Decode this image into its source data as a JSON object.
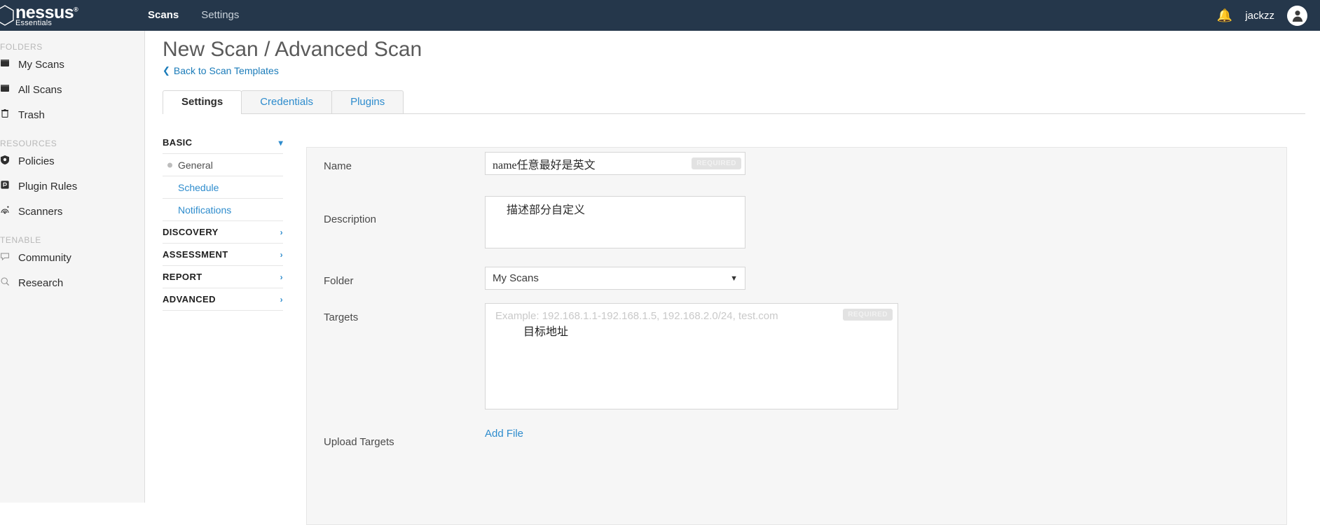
{
  "brand": {
    "name": "nessus",
    "trademark": "®",
    "edition": "Essentials",
    "logo_icon": "nessus-logo-icon"
  },
  "topnav": {
    "background": "#25374b",
    "links": [
      {
        "label": "Scans",
        "active": true
      },
      {
        "label": "Settings",
        "active": false
      }
    ],
    "notifications_icon": "bell-icon",
    "username": "jackzz",
    "avatar_icon": "user-avatar-icon"
  },
  "sidebar": {
    "groups": [
      {
        "title": "FOLDERS",
        "items": [
          {
            "label": "My Scans",
            "icon": "folder-icon"
          },
          {
            "label": "All Scans",
            "icon": "folder-icon"
          },
          {
            "label": "Trash",
            "icon": "trash-icon"
          }
        ]
      },
      {
        "title": "RESOURCES",
        "items": [
          {
            "label": "Policies",
            "icon": "shield-icon"
          },
          {
            "label": "Plugin Rules",
            "icon": "plugin-icon"
          },
          {
            "label": "Scanners",
            "icon": "scanner-icon"
          }
        ]
      },
      {
        "title": "TENABLE",
        "items": [
          {
            "label": "Community",
            "icon": "community-icon"
          },
          {
            "label": "Research",
            "icon": "research-icon"
          }
        ]
      }
    ]
  },
  "page": {
    "title": "New Scan / Advanced Scan",
    "back_link": "Back to Scan Templates",
    "back_chevron": "chevron-left-icon"
  },
  "tabs": [
    {
      "label": "Settings",
      "active": true
    },
    {
      "label": "Credentials",
      "active": false
    },
    {
      "label": "Plugins",
      "active": false
    }
  ],
  "settings_nav": [
    {
      "label": "BASIC",
      "expanded": true,
      "arrow": "chevron-down-icon",
      "children": [
        {
          "label": "General",
          "current": true
        },
        {
          "label": "Schedule",
          "current": false
        },
        {
          "label": "Notifications",
          "current": false
        }
      ]
    },
    {
      "label": "DISCOVERY",
      "expanded": false,
      "arrow": "chevron-right-icon",
      "children": []
    },
    {
      "label": "ASSESSMENT",
      "expanded": false,
      "arrow": "chevron-right-icon",
      "children": []
    },
    {
      "label": "REPORT",
      "expanded": false,
      "arrow": "chevron-right-icon",
      "children": []
    },
    {
      "label": "ADVANCED",
      "expanded": false,
      "arrow": "chevron-right-icon",
      "children": []
    }
  ],
  "form": {
    "name": {
      "label": "Name",
      "value": "name任意最好是英文",
      "placeholder": "",
      "required_badge": "REQUIRED"
    },
    "description": {
      "label": "Description",
      "value": "描述部分自定义",
      "placeholder": ""
    },
    "folder": {
      "label": "Folder",
      "value": "My Scans",
      "caret": "caret-down-icon",
      "options": [
        "My Scans"
      ]
    },
    "targets": {
      "label": "Targets",
      "value": "",
      "placeholder": "Example: 192.168.1.1-192.168.1.5, 192.168.2.0/24, test.com",
      "annotation": "目标地址",
      "required_badge": "REQUIRED"
    },
    "upload_targets": {
      "label": "Upload Targets",
      "add_file_label": "Add File"
    }
  },
  "colors": {
    "navbar": "#25374b",
    "link": "#2e8ccd",
    "panel_bg": "#f6f6f6",
    "sidebar_bg": "#f5f5f5",
    "required_badge_bg": "#e2e2e2"
  }
}
